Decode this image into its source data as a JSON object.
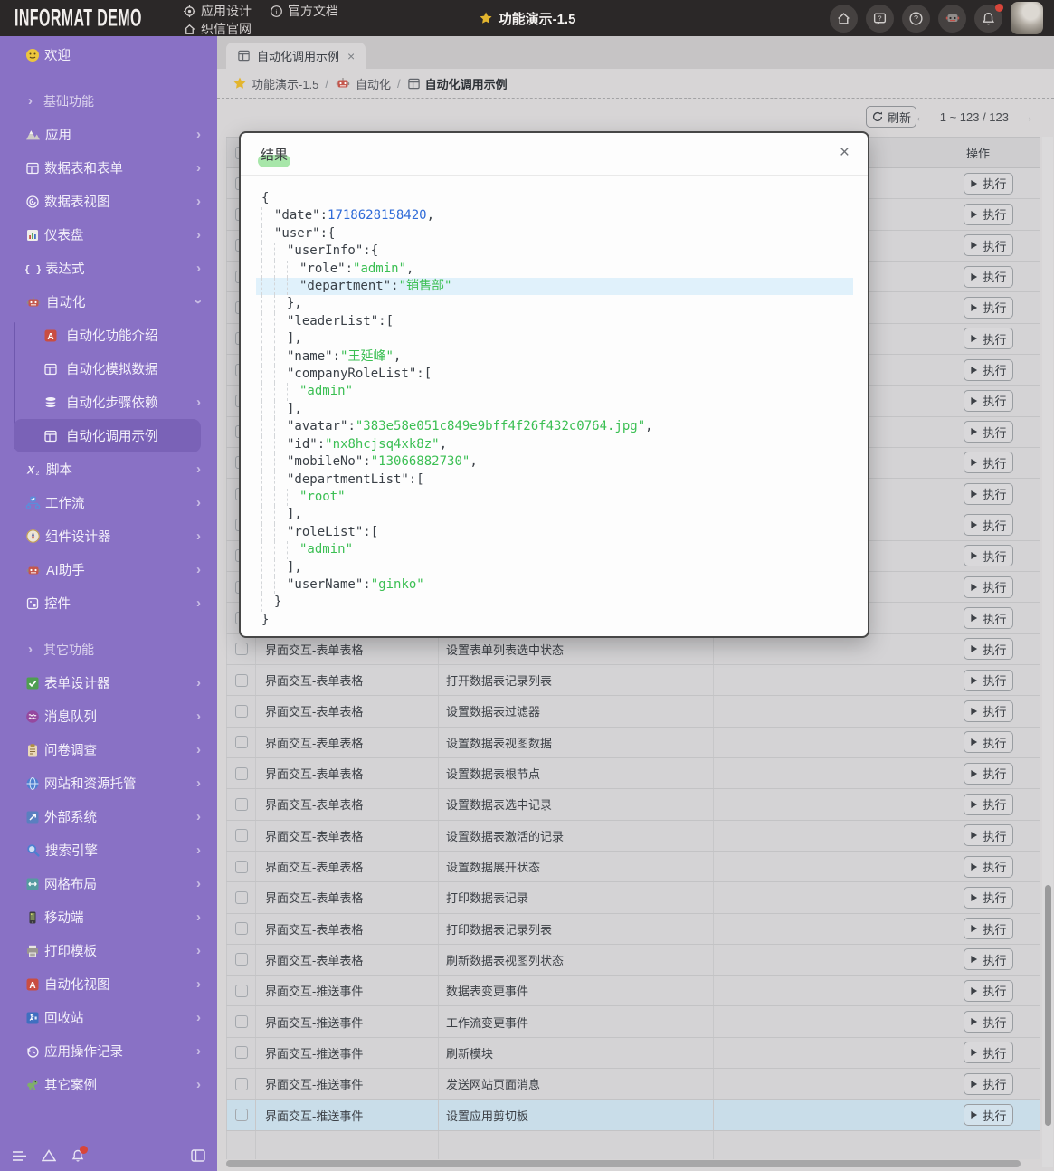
{
  "topbar": {
    "logo": "INFORMAT DEMO",
    "nav_row1": [
      {
        "icon": "gear-icon",
        "label": "应用设计"
      },
      {
        "icon": "info-icon",
        "label": "官方文档"
      }
    ],
    "nav_row2": [
      {
        "icon": "home-icon",
        "label": "织信官网"
      }
    ],
    "center_title": "功能演示-1.5",
    "right_icons": [
      "home-icon",
      "feedback-icon",
      "help-icon",
      "robot-icon",
      "bell-icon"
    ]
  },
  "sidebar": {
    "items": [
      {
        "type": "item",
        "icon": "smiley-icon",
        "label": "欢迎"
      },
      {
        "type": "group",
        "label": "基础功能"
      },
      {
        "type": "item",
        "icon": "mountain-icon",
        "label": "应用",
        "chevron": "right"
      },
      {
        "type": "item",
        "icon": "table-white-icon",
        "label": "数据表和表单",
        "chevron": "right"
      },
      {
        "type": "item",
        "icon": "view-icon",
        "label": "数据表视图",
        "chevron": "right"
      },
      {
        "type": "item",
        "icon": "dashboard-icon",
        "label": "仪表盘",
        "chevron": "right"
      },
      {
        "type": "item",
        "icon": "braces-icon",
        "label": "表达式",
        "chevron": "right"
      },
      {
        "type": "item",
        "icon": "robot-red-icon",
        "label": "自动化",
        "chevron": "down"
      },
      {
        "type": "subitem",
        "icon": "a-red-icon",
        "label": "自动化功能介绍"
      },
      {
        "type": "subitem",
        "icon": "table-white-icon",
        "label": "自动化模拟数据"
      },
      {
        "type": "subitem",
        "icon": "db-icon",
        "label": "自动化步骤依赖",
        "chevron": "right"
      },
      {
        "type": "subitem",
        "icon": "table-white-icon",
        "label": "自动化调用示例",
        "selected": true
      },
      {
        "type": "item",
        "icon": "script-icon",
        "label": "脚本",
        "chevron": "right"
      },
      {
        "type": "item",
        "icon": "workflow-icon",
        "label": "工作流",
        "chevron": "right"
      },
      {
        "type": "item",
        "icon": "compass-icon",
        "label": "组件设计器",
        "chevron": "right"
      },
      {
        "type": "item",
        "icon": "robot-red-icon",
        "label": "AI助手",
        "chevron": "right"
      },
      {
        "type": "item",
        "icon": "widget-icon",
        "label": "控件",
        "chevron": "right"
      },
      {
        "type": "group",
        "label": "其它功能"
      },
      {
        "type": "item",
        "icon": "form-check-icon",
        "label": "表单设计器",
        "chevron": "right"
      },
      {
        "type": "item",
        "icon": "queue-icon",
        "label": "消息队列",
        "chevron": "right"
      },
      {
        "type": "item",
        "icon": "clipboard-icon",
        "label": "问卷调查",
        "chevron": "right"
      },
      {
        "type": "item",
        "icon": "globe-icon",
        "label": "网站和资源托管",
        "chevron": "right"
      },
      {
        "type": "item",
        "icon": "external-icon",
        "label": "外部系统",
        "chevron": "right"
      },
      {
        "type": "item",
        "icon": "search-icon",
        "label": "搜索引擎",
        "chevron": "right"
      },
      {
        "type": "item",
        "icon": "grid-layout-icon",
        "label": "网格布局",
        "chevron": "right"
      },
      {
        "type": "item",
        "icon": "mobile-icon",
        "label": "移动端",
        "chevron": "right"
      },
      {
        "type": "item",
        "icon": "printer-icon",
        "label": "打印模板",
        "chevron": "right"
      },
      {
        "type": "item",
        "icon": "a-red-icon",
        "label": "自动化视图",
        "chevron": "right"
      },
      {
        "type": "item",
        "icon": "recycle-icon",
        "label": "回收站",
        "chevron": "right"
      },
      {
        "type": "item",
        "icon": "history-icon",
        "label": "应用操作记录",
        "chevron": "right"
      },
      {
        "type": "item",
        "icon": "dino-icon",
        "label": "其它案例",
        "chevron": "right"
      }
    ]
  },
  "tab": {
    "icon": "table-gray-icon",
    "label": "自动化调用示例",
    "close": "×"
  },
  "breadcrumb": [
    {
      "icon": "star-icon",
      "label": "功能演示-1.5"
    },
    {
      "icon": "robot-red-icon",
      "label": "自动化"
    },
    {
      "icon": "table-gray-icon",
      "label": "自动化调用示例"
    }
  ],
  "toolbar": {
    "refresh_label": "刷新",
    "pagination": "1 ~ 123 / 123",
    "prev": "←",
    "next": "→"
  },
  "table": {
    "op_header": "操作",
    "exec_label": "执行",
    "rows": [
      {
        "cat": "",
        "act": ""
      },
      {
        "cat": "",
        "act": ""
      },
      {
        "cat": "",
        "act": ""
      },
      {
        "cat": "",
        "act": ""
      },
      {
        "cat": "",
        "act": ""
      },
      {
        "cat": "",
        "act": ""
      },
      {
        "cat": "",
        "act": ""
      },
      {
        "cat": "",
        "act": ""
      },
      {
        "cat": "",
        "act": ""
      },
      {
        "cat": "",
        "act": ""
      },
      {
        "cat": "",
        "act": ""
      },
      {
        "cat": "",
        "act": ""
      },
      {
        "cat": "",
        "act": ""
      },
      {
        "cat": "",
        "act": ""
      },
      {
        "cat": "",
        "act": ""
      },
      {
        "cat": "界面交互-表单表格",
        "act": "设置表单列表选中状态"
      },
      {
        "cat": "界面交互-表单表格",
        "act": "打开数据表记录列表"
      },
      {
        "cat": "界面交互-表单表格",
        "act": "设置数据表过滤器"
      },
      {
        "cat": "界面交互-表单表格",
        "act": "设置数据表视图数据"
      },
      {
        "cat": "界面交互-表单表格",
        "act": "设置数据表根节点"
      },
      {
        "cat": "界面交互-表单表格",
        "act": "设置数据表选中记录"
      },
      {
        "cat": "界面交互-表单表格",
        "act": "设置数据表激活的记录"
      },
      {
        "cat": "界面交互-表单表格",
        "act": "设置数据展开状态"
      },
      {
        "cat": "界面交互-表单表格",
        "act": "打印数据表记录"
      },
      {
        "cat": "界面交互-表单表格",
        "act": "打印数据表记录列表"
      },
      {
        "cat": "界面交互-表单表格",
        "act": "刷新数据表视图列状态"
      },
      {
        "cat": "界面交互-推送事件",
        "act": "数据表变更事件"
      },
      {
        "cat": "界面交互-推送事件",
        "act": "工作流变更事件"
      },
      {
        "cat": "界面交互-推送事件",
        "act": "刷新模块"
      },
      {
        "cat": "界面交互-推送事件",
        "act": "发送网站页面消息"
      },
      {
        "cat": "界面交互-推送事件",
        "act": "设置应用剪切板",
        "hl": true
      }
    ]
  },
  "modal": {
    "title": "结果",
    "close": "×",
    "json_lines": [
      {
        "i": 0,
        "s": [
          [
            "p",
            "{"
          ]
        ]
      },
      {
        "i": 1,
        "s": [
          [
            "k",
            "\"date\""
          ],
          [
            "p",
            ":"
          ],
          [
            "n",
            "1718628158420"
          ],
          [
            "p",
            ","
          ]
        ]
      },
      {
        "i": 1,
        "s": [
          [
            "k",
            "\"user\""
          ],
          [
            "p",
            ":{"
          ]
        ]
      },
      {
        "i": 2,
        "s": [
          [
            "k",
            "\"userInfo\""
          ],
          [
            "p",
            ":{"
          ]
        ]
      },
      {
        "i": 3,
        "s": [
          [
            "k",
            "\"role\""
          ],
          [
            "p",
            ":"
          ],
          [
            "s",
            "\"admin\""
          ],
          [
            "p",
            ","
          ]
        ]
      },
      {
        "i": 3,
        "hl": true,
        "s": [
          [
            "k",
            "\"department\""
          ],
          [
            "p",
            ":"
          ],
          [
            "s",
            "\"销售部\""
          ]
        ]
      },
      {
        "i": 2,
        "s": [
          [
            "p",
            "},"
          ]
        ]
      },
      {
        "i": 2,
        "s": [
          [
            "k",
            "\"leaderList\""
          ],
          [
            "p",
            ":["
          ]
        ]
      },
      {
        "i": 2,
        "s": [
          [
            "p",
            "],"
          ]
        ]
      },
      {
        "i": 2,
        "s": [
          [
            "k",
            "\"name\""
          ],
          [
            "p",
            ":"
          ],
          [
            "s",
            "\"王延峰\""
          ],
          [
            "p",
            ","
          ]
        ]
      },
      {
        "i": 2,
        "s": [
          [
            "k",
            "\"companyRoleList\""
          ],
          [
            "p",
            ":["
          ]
        ]
      },
      {
        "i": 3,
        "s": [
          [
            "s",
            "\"admin\""
          ]
        ]
      },
      {
        "i": 2,
        "s": [
          [
            "p",
            "],"
          ]
        ]
      },
      {
        "i": 2,
        "s": [
          [
            "k",
            "\"avatar\""
          ],
          [
            "p",
            ":"
          ],
          [
            "s",
            "\"383e58e051c849e9bff4f26f432c0764.jpg\""
          ],
          [
            "p",
            ","
          ]
        ]
      },
      {
        "i": 2,
        "s": [
          [
            "k",
            "\"id\""
          ],
          [
            "p",
            ":"
          ],
          [
            "s",
            "\"nx8hcjsq4xk8z\""
          ],
          [
            "p",
            ","
          ]
        ]
      },
      {
        "i": 2,
        "s": [
          [
            "k",
            "\"mobileNo\""
          ],
          [
            "p",
            ":"
          ],
          [
            "s",
            "\"13066882730\""
          ],
          [
            "p",
            ","
          ]
        ]
      },
      {
        "i": 2,
        "s": [
          [
            "k",
            "\"departmentList\""
          ],
          [
            "p",
            ":["
          ]
        ]
      },
      {
        "i": 3,
        "s": [
          [
            "s",
            "\"root\""
          ]
        ]
      },
      {
        "i": 2,
        "s": [
          [
            "p",
            "],"
          ]
        ]
      },
      {
        "i": 2,
        "s": [
          [
            "k",
            "\"roleList\""
          ],
          [
            "p",
            ":["
          ]
        ]
      },
      {
        "i": 3,
        "s": [
          [
            "s",
            "\"admin\""
          ]
        ]
      },
      {
        "i": 2,
        "s": [
          [
            "p",
            "],"
          ]
        ]
      },
      {
        "i": 2,
        "s": [
          [
            "k",
            "\"userName\""
          ],
          [
            "p",
            ":"
          ],
          [
            "s",
            "\"ginko\""
          ]
        ]
      },
      {
        "i": 1,
        "s": [
          [
            "p",
            "}"
          ]
        ]
      },
      {
        "i": 0,
        "s": [
          [
            "p",
            "}"
          ]
        ]
      }
    ]
  }
}
